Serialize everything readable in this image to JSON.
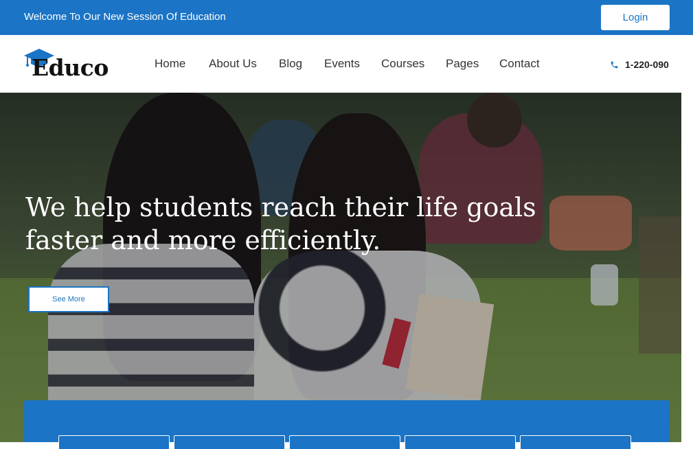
{
  "topbar": {
    "welcome": "Welcome To Our New Session Of Education",
    "login_label": "Login"
  },
  "header": {
    "brand": "Educo",
    "nav": [
      "Home",
      "About Us",
      "Blog",
      "Events",
      "Courses",
      "Pages",
      "Contact"
    ],
    "phone": "1-220-090"
  },
  "hero": {
    "headline_line1": "We help students reach their life goals",
    "headline_line2": "faster and more efficiently.",
    "cta_label": "See More"
  },
  "colors": {
    "primary": "#1b74c5",
    "text_dark": "#333333",
    "white": "#ffffff"
  },
  "icons": {
    "logo": "graduation-cap-icon",
    "phone": "phone-icon"
  }
}
